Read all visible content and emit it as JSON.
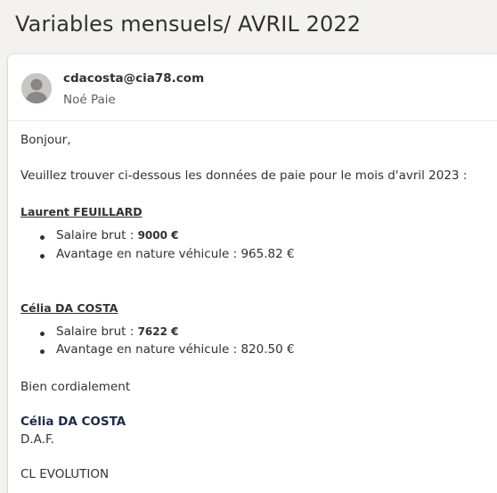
{
  "subject": "Variables mensuels/ AVRIL 2022",
  "sender": {
    "avatar_icon": "person-placeholder-icon",
    "email": "cdacosta@cia78.com",
    "name": "Noé Paie"
  },
  "message": {
    "greeting": "Bonjour,",
    "intro": "Veuillez trouver ci-dessous les données de paie pour le mois d'avril 2023 :",
    "employees": [
      {
        "name": "Laurent FEUILLARD",
        "salary_label": "Salaire brut : ",
        "salary_value": "9000 €",
        "benefit_line": "Avantage en nature véhicule : 965.82 €"
      },
      {
        "name": "Célia DA COSTA",
        "salary_label": "Salaire brut : ",
        "salary_value": "7622 €",
        "benefit_line": "Avantage en nature véhicule : 820.50 €"
      }
    ],
    "closing": "Bien cordialement",
    "signature": {
      "name": "Célia DA COSTA",
      "title": "D.A.F.",
      "company": "CL EVOLUTION"
    }
  }
}
